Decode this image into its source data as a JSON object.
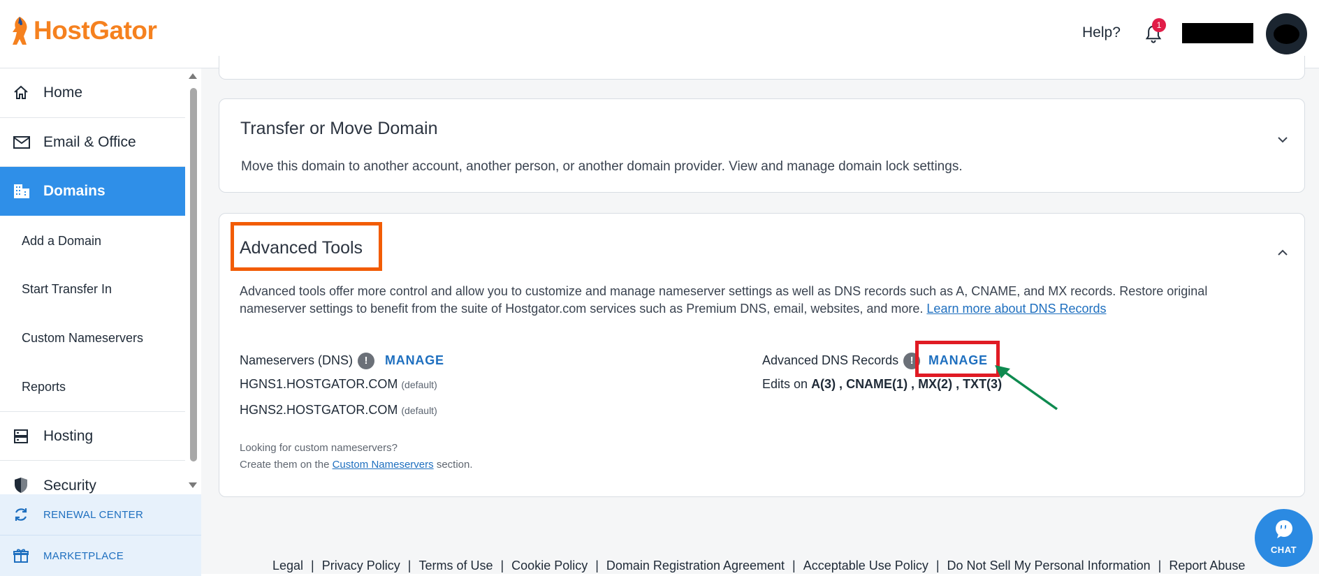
{
  "header": {
    "logo_text": "HostGator",
    "help_label": "Help?",
    "notification_count": "1"
  },
  "sidebar": {
    "items": [
      {
        "label": "Home",
        "icon": "home-icon"
      },
      {
        "label": "Email & Office",
        "icon": "mail-icon"
      },
      {
        "label": "Domains",
        "icon": "domains-icon"
      },
      {
        "label": "Hosting",
        "icon": "server-icon"
      },
      {
        "label": "Security",
        "icon": "shield-icon"
      }
    ],
    "sub_items": [
      "Add a Domain",
      "Start Transfer In",
      "Custom Nameservers",
      "Reports"
    ],
    "bottom": [
      {
        "label": "RENEWAL CENTER",
        "icon": "refresh-icon"
      },
      {
        "label": "MARKETPLACE",
        "icon": "gift-icon"
      }
    ]
  },
  "transfer": {
    "title": "Transfer or Move Domain",
    "desc": "Move this domain to another account, another person, or another domain provider. View and manage domain lock settings."
  },
  "advanced": {
    "title": "Advanced Tools",
    "desc": "Advanced tools offer more control and allow you to customize and manage nameserver settings as well as DNS records such as A, CNAME, and MX records. Restore original nameserver settings to benefit from the suite of Hostgator.com services such as Premium DNS, email, websites, and more.",
    "learn_link": "Learn more about DNS Records",
    "ns_label": "Nameservers (DNS)",
    "ns_manage": "MANAGE",
    "ns1": "HGNS1.HOSTGATOR.COM",
    "ns2": "HGNS2.HOSTGATOR.COM",
    "default_tag": "(default)",
    "adv_label": "Advanced DNS Records",
    "adv_manage": "MANAGE",
    "edits_prefix": "Edits on",
    "edits_values": "A(3) , CNAME(1) , MX(2) , TXT(3)",
    "note_line1": "Looking for custom nameservers?",
    "note_line2_prefix": "Create them on the",
    "note_link": "Custom Nameservers",
    "note_line2_suffix": "section."
  },
  "footer": {
    "links": [
      "Legal",
      "Privacy Policy",
      "Terms of Use",
      "Cookie Policy",
      "Domain Registration Agreement",
      "Acceptable Use Policy",
      "Do Not Sell My Personal Information",
      "Report Abuse"
    ]
  },
  "chat": {
    "label": "CHAT"
  },
  "colors": {
    "brand": "#f5811f",
    "accent": "#2f8fe8",
    "link": "#1e6fbf",
    "highlight_orange": "#f25c05",
    "highlight_red": "#e01b24",
    "arrow_green": "#0e8a4f"
  }
}
